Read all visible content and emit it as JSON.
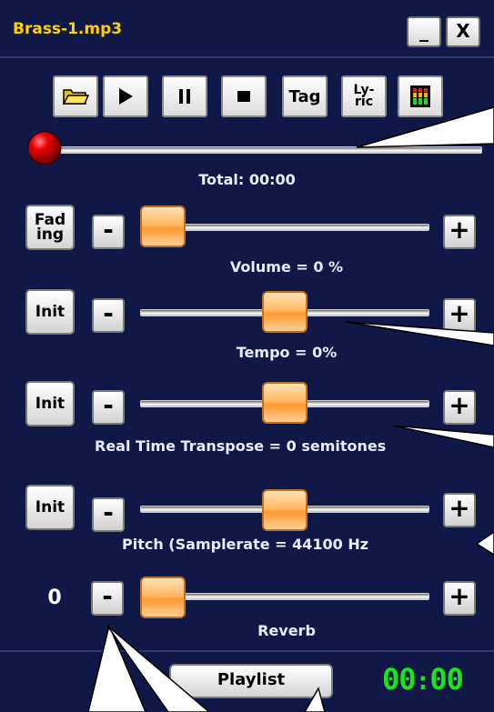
{
  "window": {
    "title": "Brass-1.mp3",
    "minimize_label": "_",
    "close_label": "X"
  },
  "toolbar": {
    "open_icon": "folder-open-icon",
    "play_icon": "play-icon",
    "pause_icon": "pause-icon",
    "stop_icon": "stop-icon",
    "tag_label": "Tag",
    "lyric_label_top": "Ly-",
    "lyric_label_bottom": "ric",
    "levels_icon": "level-meter-icon"
  },
  "progress": {
    "label": "Total: 00:00",
    "position_fraction": 0.0
  },
  "volume": {
    "side_button": "Fad ing",
    "minus": "-",
    "plus": "+",
    "label": "Volume = 0 %",
    "value_fraction": 0.0
  },
  "tempo": {
    "side_button": "Init",
    "minus": "-",
    "plus": "+",
    "label": "Tempo = 0%",
    "value_fraction": 0.5
  },
  "transpose": {
    "side_button": "Init",
    "minus": "-",
    "plus": "+",
    "label": "Real Time Transpose = 0 semitones",
    "value_fraction": 0.5
  },
  "pitch": {
    "side_button": "Init",
    "minus": "-",
    "plus": "+",
    "label": "Pitch (Samplerate = 44100 Hz",
    "value_fraction": 0.5
  },
  "reverb": {
    "value": "0",
    "minus": "-",
    "plus": "+",
    "label": "Reverb",
    "value_fraction": 0.0
  },
  "footer": {
    "playlist_label": "Playlist",
    "time_minutes": "00",
    "time_sep": ":",
    "time_seconds": "00"
  },
  "colors": {
    "background": "#101848",
    "title_text": "#ffd000",
    "clock": "#19e619",
    "thumb": "#ff9a30"
  }
}
